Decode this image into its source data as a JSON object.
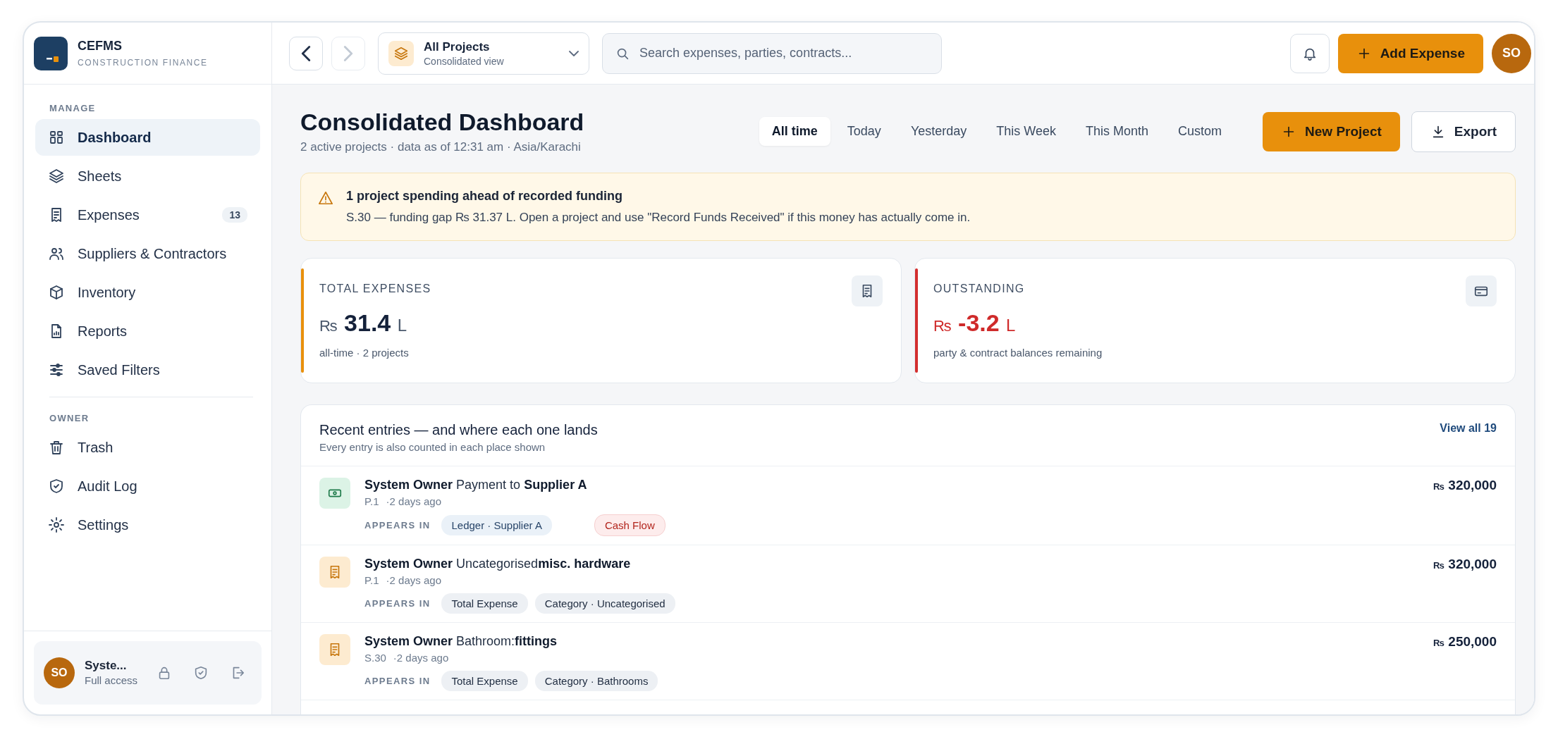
{
  "app": {
    "name": "CEFMS",
    "tagline": "CONSTRUCTION FINANCE"
  },
  "sidebar": {
    "sections": [
      {
        "title": "MANAGE",
        "items": [
          {
            "label": "Dashboard",
            "selected": true
          },
          {
            "label": "Sheets",
            "selected": false
          },
          {
            "label": "Expenses",
            "selected": false,
            "badge": "13"
          },
          {
            "label": "Suppliers & Contractors",
            "selected": false
          },
          {
            "label": "Inventory",
            "selected": false
          },
          {
            "label": "Reports",
            "selected": false
          },
          {
            "label": "Saved Filters",
            "selected": false
          }
        ]
      },
      {
        "title": "OWNER",
        "items": [
          {
            "label": "Trash",
            "selected": false
          },
          {
            "label": "Audit Log",
            "selected": false
          },
          {
            "label": "Settings",
            "selected": false
          }
        ]
      }
    ],
    "user": {
      "initials": "SO",
      "name": "Syste...",
      "role": "Full access"
    }
  },
  "topbar": {
    "nav_buttons": [
      {
        "kind": "back",
        "disabled": false
      },
      {
        "kind": "forward",
        "disabled": true
      }
    ],
    "project": {
      "title": "All Projects",
      "subtitle": "Consolidated view"
    },
    "search": {
      "placeholder": "Search expenses, parties, contracts..."
    },
    "primary_button": "Add Expense",
    "avatar": "SO"
  },
  "header": {
    "title": "Consolidated Dashboard",
    "subtitle": "2 active projects · data as of 12:31 am · Asia/Karachi",
    "ranges": [
      {
        "label": "All time",
        "selected": true
      },
      {
        "label": "Today",
        "selected": false
      },
      {
        "label": "Yesterday",
        "selected": false
      },
      {
        "label": "This Week",
        "selected": false
      },
      {
        "label": "This Month",
        "selected": false
      },
      {
        "label": "Custom",
        "selected": false
      }
    ],
    "buttons": [
      {
        "label": "New Project",
        "kind": "primary"
      },
      {
        "label": "Export",
        "kind": "secondary"
      }
    ]
  },
  "alert": {
    "title": "1 project spending ahead of recorded funding",
    "message": "S.30 — funding gap ₨ 31.37 L. Open a project and use \"Record Funds Received\" if this money has actually come in."
  },
  "stats": [
    {
      "label": "TOTAL EXPENSES",
      "currency": "₨",
      "value": "31.4",
      "unit": "L",
      "note": "all-time · 2 projects",
      "color": "#e8900c",
      "kind": "neutral"
    },
    {
      "label": "OUTSTANDING",
      "currency": "₨",
      "value": "-3.2",
      "unit": "L",
      "note": "party & contract balances remaining",
      "color": "#d32f2f",
      "kind": "negative"
    }
  ],
  "recent": {
    "title": "Recent entries — and where each one lands",
    "subtitle": "Every entry is also counted in each place shown",
    "link": "View all 19",
    "entries": [
      {
        "kind": "payment",
        "title": "**System Owner** Payment to **Supplier A**",
        "project": "P.1",
        "time": "·2 days ago",
        "currency": "₨",
        "amount": "320,000",
        "appears_label": "APPEARS IN",
        "tags": [
          {
            "label": "Ledger · Supplier A",
            "kind": "info"
          },
          {
            "label": "Cash Flow",
            "kind": "danger"
          }
        ]
      },
      {
        "kind": "expense",
        "title": "**System Owner** Uncategorised**misc. hardware**",
        "project": "P.1",
        "time": "·2 days ago",
        "currency": "₨",
        "amount": "320,000",
        "appears_label": "APPEARS IN",
        "tags": [
          {
            "label": "Total Expense",
            "kind": "neutral"
          },
          {
            "label": "Category · Uncategorised",
            "kind": "neutral"
          }
        ]
      },
      {
        "kind": "expense",
        "title": "**System Owner** Bathroom:**fittings**",
        "project": "S.30",
        "time": "·2 days ago",
        "currency": "₨",
        "amount": "250,000",
        "appears_label": "APPEARS IN",
        "tags": [
          {
            "label": "Total Expense",
            "kind": "neutral"
          },
          {
            "label": "Category · Bathrooms",
            "kind": "neutral"
          }
        ]
      }
    ]
  }
}
